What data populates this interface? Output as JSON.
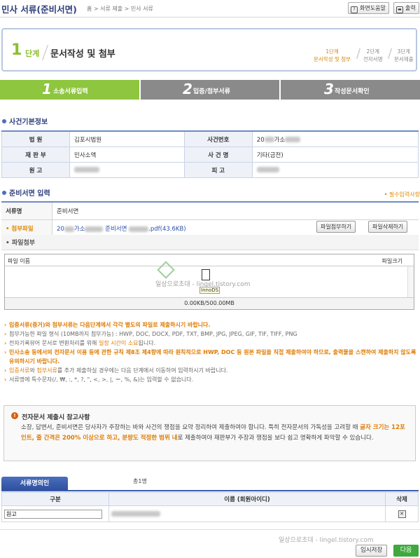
{
  "header": {
    "title": "민사 서류(준비서면)",
    "breadcrumb": "홈 > 서류 제출 > 민사 서류",
    "help_label": "화면도움말",
    "print_label": "출력"
  },
  "step": {
    "number": "1",
    "unit": "단계",
    "title": "문서작성 및 첨부",
    "nav": [
      {
        "line1": "1단계",
        "line2": "문서작성 및 첨부"
      },
      {
        "line1": "2단계",
        "line2": "전자서명"
      },
      {
        "line1": "3단계",
        "line2": "문서제출"
      }
    ]
  },
  "progress_tabs": [
    {
      "num": "1",
      "label": "소송서류입력"
    },
    {
      "num": "2",
      "label": "입증/첨부서류"
    },
    {
      "num": "3",
      "label": "작성문서확인"
    }
  ],
  "case_info": {
    "heading": "사건기본정보",
    "court_label": "법 원",
    "court": "김포시법원",
    "case_no_label": "사건번호",
    "case_no_prefix": "20",
    "case_no_mid": "가소",
    "division_label": "재 판 부",
    "division": "민사소액",
    "case_name_label": "사 건 명",
    "case_name": "기타(금전)",
    "plaintiff_label": "원 고",
    "defendant_label": "피 고"
  },
  "prep": {
    "heading": "준비서면 입력",
    "required_note": "• 필수입력사항",
    "doc_name_label": "서류명",
    "doc_name": "준비서면",
    "attach_label": "• 첨부파일",
    "attach_prefix": "20",
    "attach_mid": "가소",
    "attach_doc": "준비서면",
    "attach_suffix": ".pdf(43.6KB)",
    "attach_btn": "파일첨부하기",
    "delete_btn": "파일삭제하기"
  },
  "uploader": {
    "section": "• 파일첨부",
    "col_name": "파일 이름",
    "col_size": "파일크기",
    "total": "0.00KB/500.00MB",
    "drop_label": "InnoDS",
    "watermark": "일상으로초대 - lingel.tistory.com"
  },
  "notes": {
    "n1": "입증서류(증거)와 첨부서류는 다음단계에서 각각 별도의 파일로 제출하시기 바랍니다.",
    "n2": "첨부가능한 파일 형식 (10MB까지 첨부가능) : HWP, DOC, DOCX, PDF, TXT, BMP, JPG, JPEG, GIF, TIF, TIFF, PNG",
    "n3_a": "전자기록뷰어 문서로 변환처리를 위해 ",
    "n3_b": "일정 시간이 소요",
    "n3_c": "됩니다.",
    "n4": "민사소송 등에서의 전자문서 이용 등에 관한 규칙 제8조 제4항에 따라 원칙적으로 HWP, DOC 등 원본 파일을 직접 제출하여야 하므로, 출력물을 스캔하여 제출하지 않도록 유의하시기 바랍니다.",
    "n5_a": "입증서류",
    "n5_b": "와 ",
    "n5_c": "첨부서류",
    "n5_d": "를 추가 제출하실 경우에는 다음 단계에서 이동하여 입력하시기 바랍니다.",
    "n6": "서류명에 특수문자(/, ₩, :, *, ?, \", <, >, |, ＝, %, &)는 입력할 수 없습니다."
  },
  "reference": {
    "icon": "!",
    "title": "전자문서 제출시 참고사항",
    "body_a": "소장, 답변서, 준비서면은 당사자가 주장하는 바와 사건의 쟁점을 요약 정리하여 제출하여야 합니다. 특히 전자문서의 가독성을 고려할 때 ",
    "body_b": "글자 크기는 12포인트, 줄 간격은 200% 이상으로 하고, 분량도 적정한 범위 내",
    "body_c": "로 제출하여야 재판부가 주장과 쟁점을 보다 쉽고 명확하게 파악할 수 있습니다."
  },
  "signers": {
    "tab": "서류명의인",
    "count": "총1명",
    "col_kind": "구분",
    "col_name": "이름 (회원아이디)",
    "col_delete": "삭제",
    "rows": [
      {
        "kind": "원고"
      }
    ]
  },
  "footer": {
    "watermark": "일상으로초대 - lingel.tistory.com",
    "temp_save": "임시저장",
    "next": "다음"
  },
  "colors": {
    "accent_green": "#8ec63f",
    "inactive_tab": "#8a8a8a",
    "title_navy": "#2e3f7c",
    "warning_orange": "#e07b00"
  }
}
